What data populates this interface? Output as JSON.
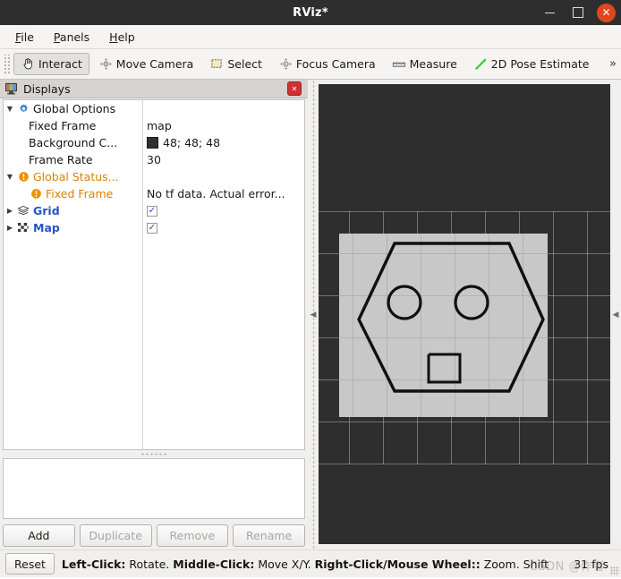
{
  "window": {
    "title": "RViz*",
    "minimize_label": "minimize",
    "maximize_label": "maximize",
    "close_label": "✕"
  },
  "menubar": {
    "items": [
      {
        "label": "File",
        "mnemonic": "F"
      },
      {
        "label": "Panels",
        "mnemonic": "P"
      },
      {
        "label": "Help",
        "mnemonic": "H"
      }
    ]
  },
  "toolbar": {
    "buttons": [
      {
        "label": "Interact",
        "icon": "hand-cursor-icon",
        "active": true
      },
      {
        "label": "Move Camera",
        "icon": "move-camera-icon",
        "active": false
      },
      {
        "label": "Select",
        "icon": "select-box-icon",
        "active": false
      },
      {
        "label": "Focus Camera",
        "icon": "focus-camera-icon",
        "active": false
      },
      {
        "label": "Measure",
        "icon": "ruler-icon",
        "active": false
      },
      {
        "label": "2D Pose Estimate",
        "icon": "pose-arrow-icon",
        "active": false
      }
    ],
    "overflow_label": "»"
  },
  "displays_panel": {
    "title": "Displays",
    "panel_icon": "displays-monitor-icon",
    "close_label": "✕",
    "tree": [
      {
        "label": "Global Options",
        "label_style": "black",
        "icon": "gear-icon",
        "indent": 0,
        "expander": "down",
        "value_type": "none",
        "value": ""
      },
      {
        "label": "Fixed Frame",
        "label_style": "black",
        "icon": "none",
        "indent": 1,
        "expander": "none",
        "value_type": "text",
        "value": "map"
      },
      {
        "label": "Background C...",
        "label_style": "black",
        "icon": "none",
        "indent": 1,
        "expander": "none",
        "value_type": "color",
        "value": "48; 48; 48",
        "swatch_color": "#303030"
      },
      {
        "label": "Frame Rate",
        "label_style": "black",
        "icon": "none",
        "indent": 1,
        "expander": "none",
        "value_type": "text",
        "value": "30"
      },
      {
        "label": "Global Status...",
        "label_style": "orange",
        "icon": "warning-icon",
        "indent": 0,
        "expander": "down",
        "value_type": "none",
        "value": ""
      },
      {
        "label": "Fixed Frame",
        "label_style": "orange",
        "icon": "warning-icon",
        "indent": 1,
        "expander": "none",
        "value_type": "text",
        "value": "No tf data.  Actual error..."
      },
      {
        "label": "Grid",
        "label_style": "blue",
        "icon": "grid-layers-icon",
        "indent": 0,
        "expander": "right",
        "value_type": "checkbox",
        "value": "✓"
      },
      {
        "label": "Map",
        "label_style": "blue",
        "icon": "map-checker-icon",
        "indent": 0,
        "expander": "right",
        "value_type": "checkbox",
        "value": "✓"
      }
    ],
    "buttons": [
      {
        "label": "Add",
        "enabled": true
      },
      {
        "label": "Duplicate",
        "enabled": false
      },
      {
        "label": "Remove",
        "enabled": false
      },
      {
        "label": "Rename",
        "enabled": false
      }
    ]
  },
  "splitters": {
    "left_arrow": "◀",
    "right_arrow": "◀"
  },
  "render_view": {
    "background_color": "#2e2e2e",
    "map_color": "#c8c8c8",
    "occupancy_color": "#000000"
  },
  "statusbar": {
    "reset_label": "Reset",
    "hint_segments": [
      {
        "text": "Left-Click:",
        "bold": true
      },
      {
        "text": " Rotate. ",
        "bold": false
      },
      {
        "text": "Middle-Click:",
        "bold": true
      },
      {
        "text": " Move X/Y. ",
        "bold": false
      },
      {
        "text": "Right-Click/Mouse Wheel::",
        "bold": true
      },
      {
        "text": " Zoom. Shift",
        "bold": false
      }
    ],
    "fps": "31 fps",
    "watermark": "CSDN @作者"
  }
}
